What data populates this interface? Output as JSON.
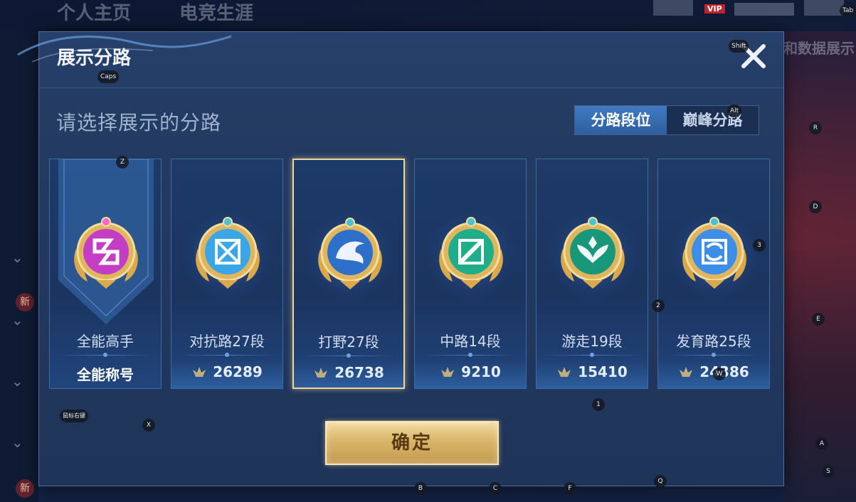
{
  "background": {
    "tabs": [
      "个人主页",
      "电竞生涯"
    ],
    "right_text": "和数据展示",
    "vip_label": "VIP",
    "xin_badge": "新"
  },
  "modal": {
    "title": "展示分路",
    "subtitle": "请选择展示的分路",
    "toggle": [
      {
        "label": "分路段位",
        "active": true
      },
      {
        "label": "巅峰分路",
        "active": false
      }
    ],
    "cards": [
      {
        "lane": "全能高手",
        "value": "全能称号",
        "icon": "all-round-badge-icon",
        "color": "#c33ec4",
        "selected": false,
        "is_title": true
      },
      {
        "lane": "对抗路27段",
        "value": "26289",
        "icon": "clash-lane-badge-icon",
        "color": "#39a7e6",
        "selected": false
      },
      {
        "lane": "打野27段",
        "value": "26738",
        "icon": "jungle-badge-icon",
        "color": "#2d6fc9",
        "selected": true
      },
      {
        "lane": "中路14段",
        "value": "9210",
        "icon": "mid-lane-badge-icon",
        "color": "#1fae8a",
        "selected": false
      },
      {
        "lane": "游走19段",
        "value": "15410",
        "icon": "roam-badge-icon",
        "color": "#19977a",
        "selected": false
      },
      {
        "lane": "发育路25段",
        "value": "24386",
        "icon": "farm-lane-badge-icon",
        "color": "#3c8ee8",
        "selected": false
      }
    ],
    "confirm_label": "确定"
  },
  "key_hints": [
    "Tab",
    "Shift",
    "Alt",
    "Caps",
    "Z",
    "R",
    "D",
    "3",
    "2",
    "E",
    "1",
    "W",
    "X",
    "鼠标右键",
    "A",
    "S",
    "Q",
    "B",
    "C",
    "F"
  ],
  "colors": {
    "gold": "#d9b56a",
    "selected_border": "#f1d69a",
    "panel": "#20365d"
  }
}
